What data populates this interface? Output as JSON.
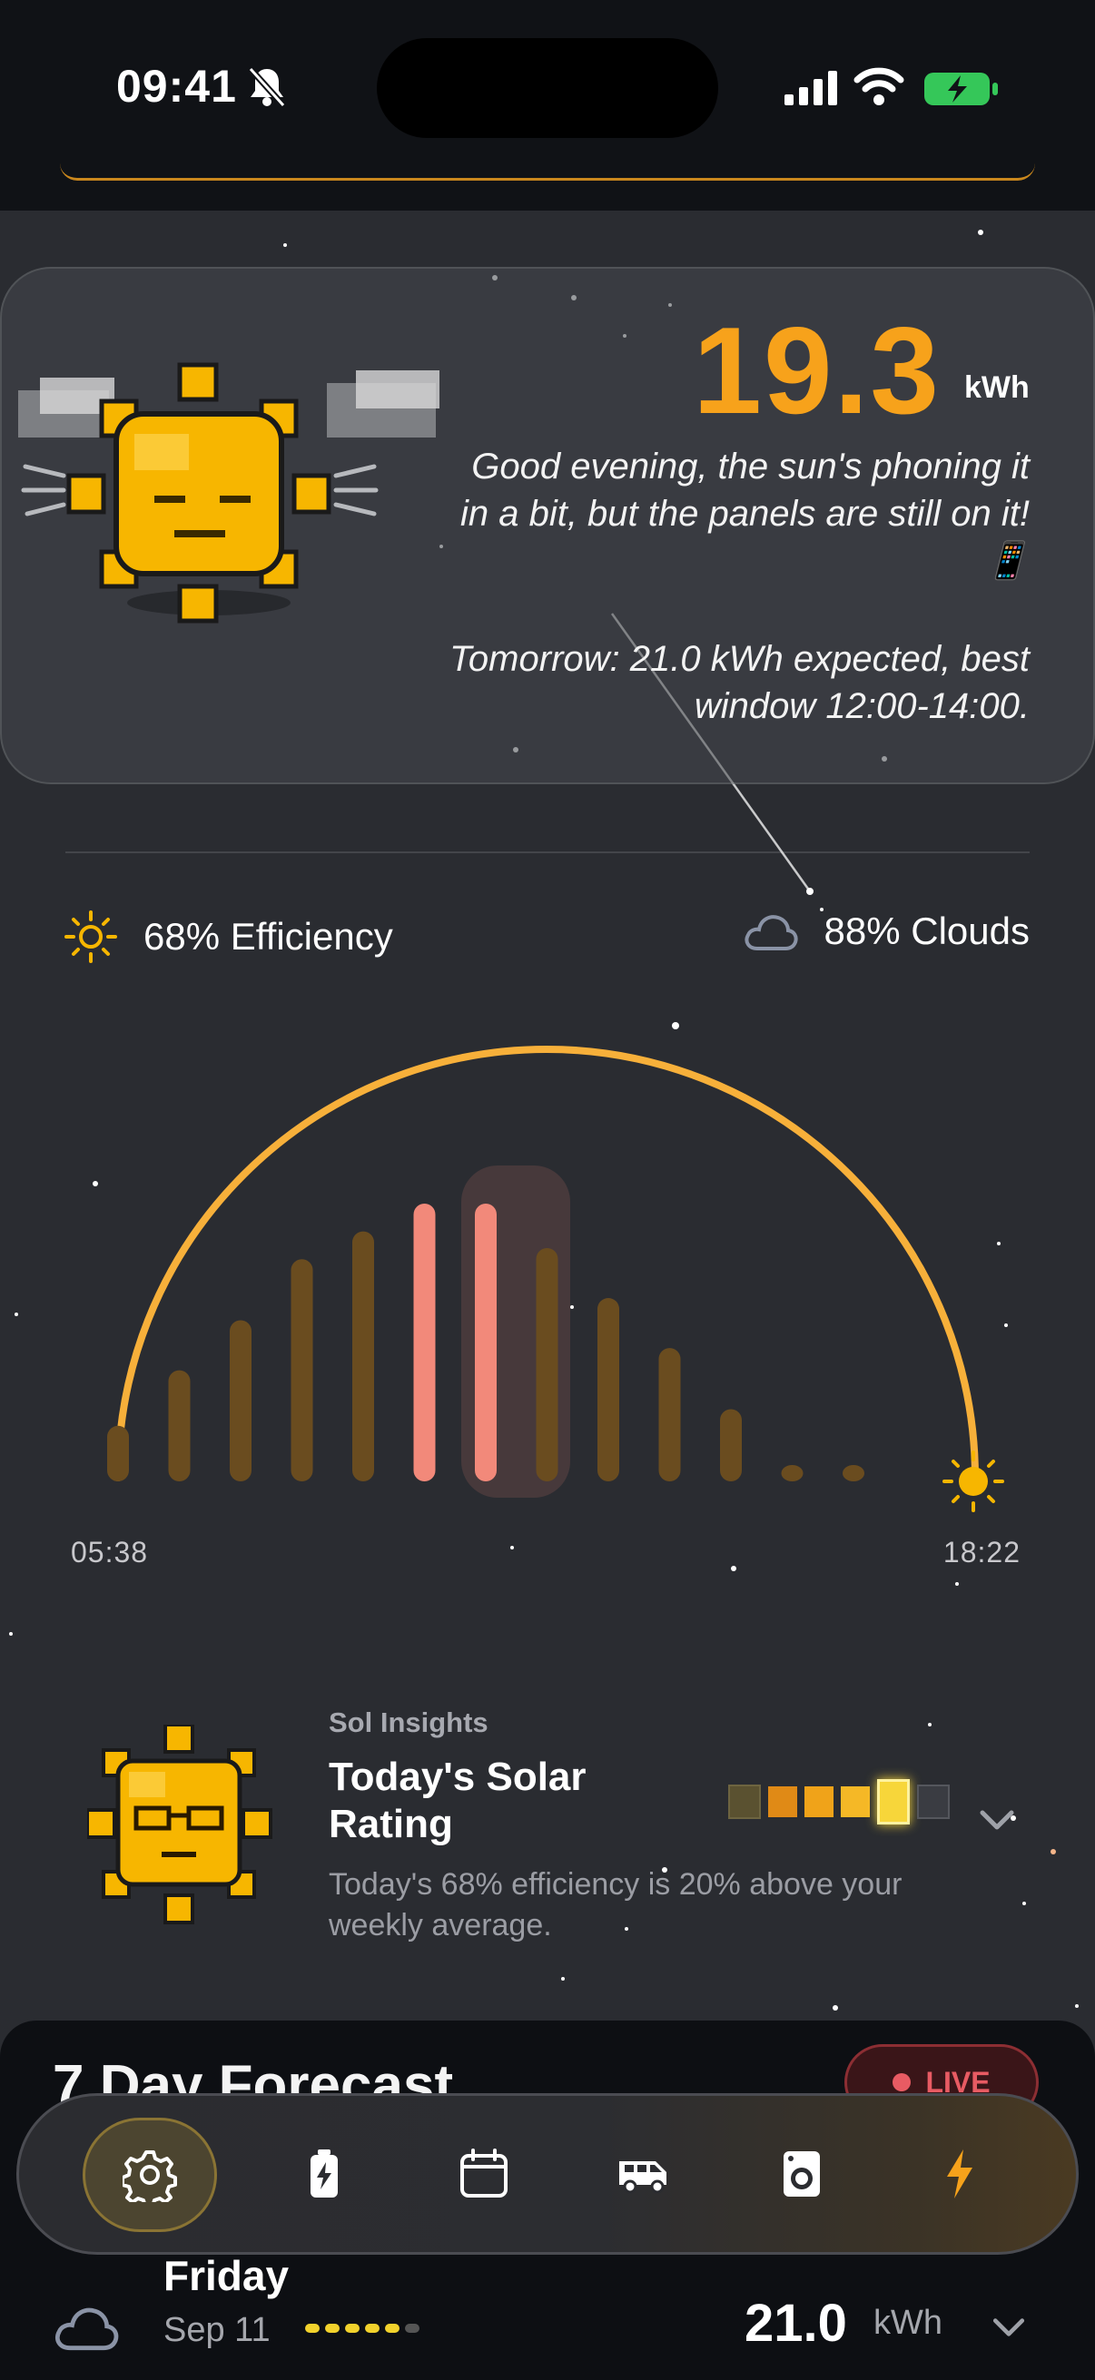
{
  "status_bar": {
    "time": "09:41",
    "icons": [
      "bell-slash-icon",
      "cellular-signal-icon",
      "wifi-icon",
      "battery-charging-icon"
    ]
  },
  "hero": {
    "energy_value": "19.3",
    "energy_unit": "kWh",
    "greeting": "Good evening, the sun's phoning it in a bit, but the panels are still on it! 📱",
    "tomorrow": "Tomorrow: 21.0 kWh expected, best window 12:00-14:00."
  },
  "stats": {
    "efficiency": "68% Efficiency",
    "clouds": "88% Clouds"
  },
  "chart_data": {
    "type": "bar",
    "title": "",
    "xlabel": "",
    "ylabel": "",
    "x_range_labels": [
      "05:38",
      "18:22"
    ],
    "categories": [
      "",
      "",
      "",
      "",
      "",
      "",
      "",
      "",
      "",
      "",
      "",
      "",
      ""
    ],
    "values": [
      0.2,
      0.4,
      0.58,
      0.8,
      0.9,
      1.0,
      1.0,
      0.84,
      0.66,
      0.48,
      0.26,
      0.05,
      0.0
    ],
    "highlight_indices": [
      5,
      6
    ],
    "colors": {
      "bar": "#6a4c1f",
      "highlight": "#f2897a",
      "arc": "#f7b03a"
    }
  },
  "sunrise": "05:38",
  "sunset": "18:22",
  "insight": {
    "kicker": "Sol Insights",
    "title": "Today's Solar Rating",
    "description": "Today's 68% efficiency is 20% above your weekly average.",
    "rating_filled": 5,
    "rating_total": 6
  },
  "forecast": {
    "title": "7 Day Forecast",
    "live_label": "LIVE",
    "rows": [
      {
        "day": "Friday",
        "date": "Sep 11",
        "kwh": "21.0",
        "unit": "kWh",
        "icon": "cloud-icon"
      }
    ]
  },
  "nav": {
    "items": [
      "settings-icon",
      "battery-icon",
      "calendar-icon",
      "van-icon",
      "washer-icon",
      "lightning-icon"
    ],
    "active": "settings-icon"
  },
  "colors": {
    "accent": "#f7a21b",
    "background": "#2a2c31",
    "live": "#e85b63"
  }
}
